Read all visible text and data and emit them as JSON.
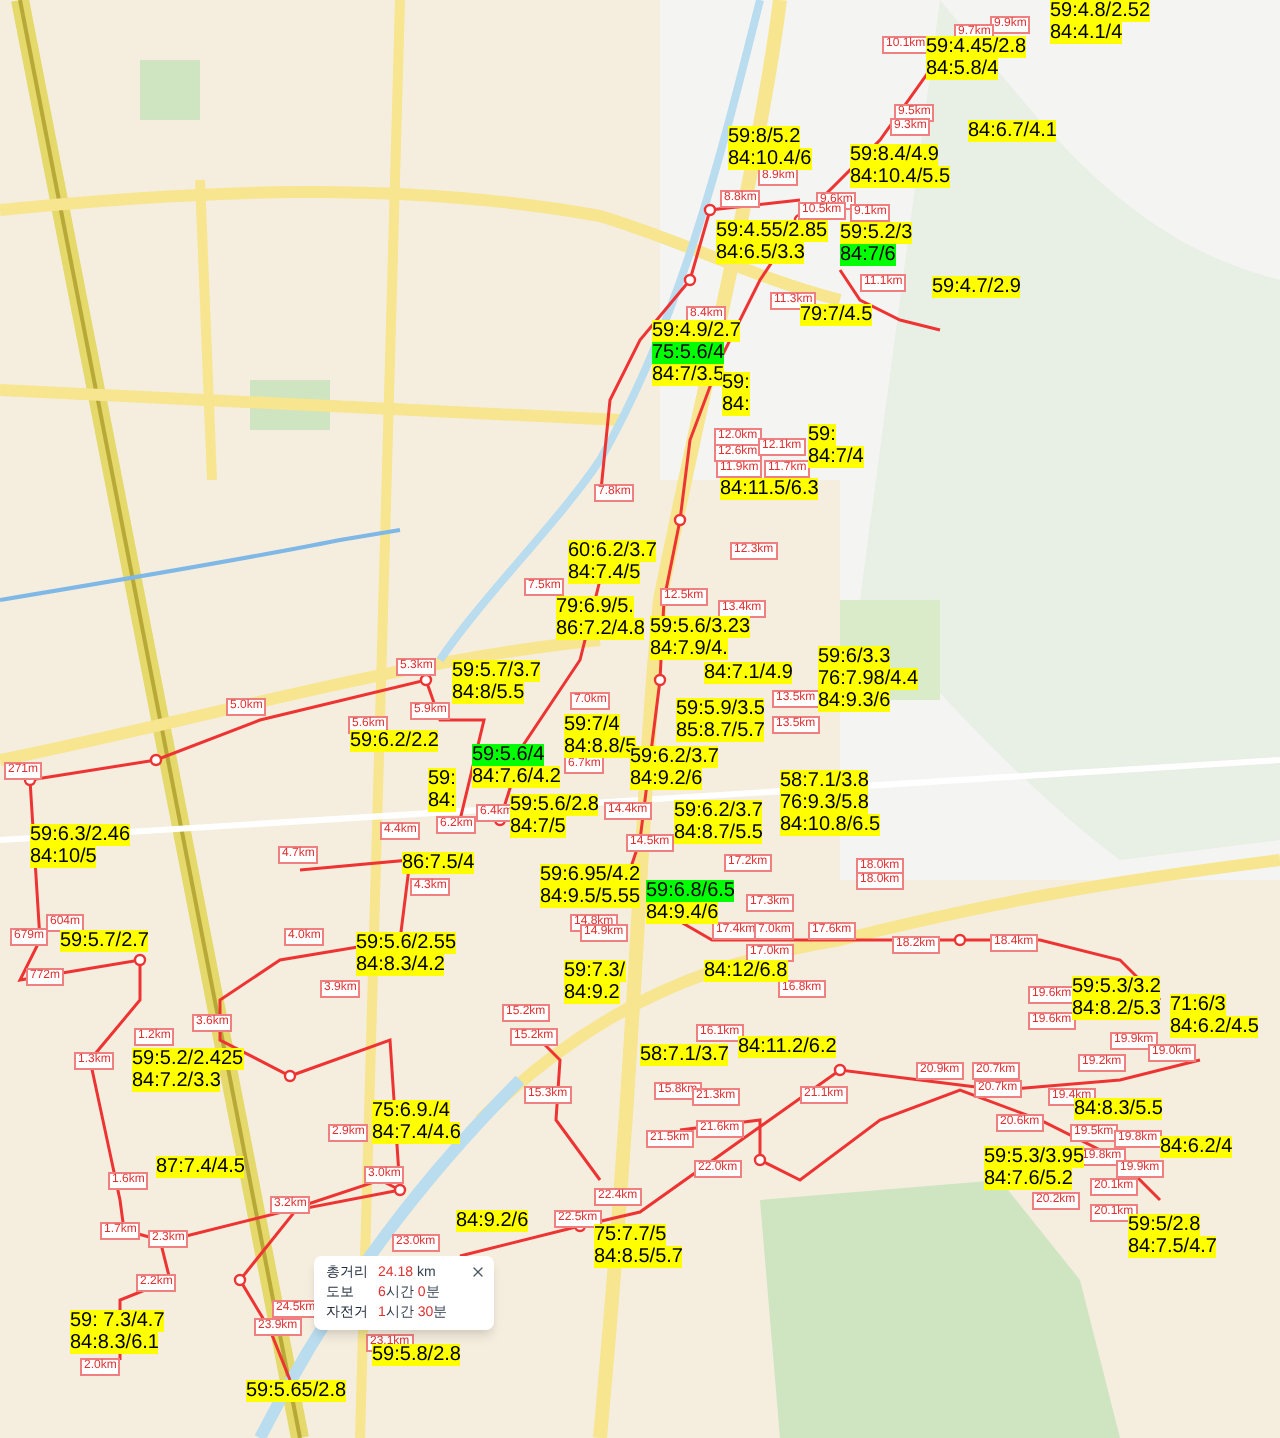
{
  "route_labels": [
    {
      "lines": [
        {
          "text": "59:4.8/2.52",
          "highlighted": false
        },
        {
          "text": "84:4.1/4",
          "highlighted": false
        }
      ]
    },
    {
      "lines": [
        {
          "text": "59:4.45/2.8",
          "highlighted": false
        },
        {
          "text": "84:5.8/4",
          "highlighted": false
        }
      ]
    },
    {
      "lines": [
        {
          "text": "84:6.7/4.1",
          "highlighted": false
        }
      ]
    },
    {
      "lines": [
        {
          "text": "59:8/5.2",
          "highlighted": false
        },
        {
          "text": "84:10.4/6",
          "highlighted": false
        }
      ]
    },
    {
      "lines": [
        {
          "text": "59:8.4/4.9",
          "highlighted": false
        },
        {
          "text": "84:10.4/5.5",
          "highlighted": false
        }
      ]
    },
    {
      "lines": [
        {
          "text": "59:4.55/2.85",
          "highlighted": false
        },
        {
          "text": "84:6.5/3.3",
          "highlighted": false
        }
      ]
    },
    {
      "lines": [
        {
          "text": "59:5.2/3",
          "highlighted": false
        },
        {
          "text": "84:7/6",
          "highlighted": true
        }
      ]
    },
    {
      "lines": [
        {
          "text": "59:4.7/2.9",
          "highlighted": false
        }
      ]
    },
    {
      "lines": [
        {
          "text": "79:7/4.5",
          "highlighted": false
        }
      ]
    },
    {
      "lines": [
        {
          "text": "59:4.9/2.7",
          "highlighted": false
        },
        {
          "text": "75:5.6/4",
          "highlighted": true
        },
        {
          "text": "84:7/3.5",
          "highlighted": false
        }
      ]
    },
    {
      "lines": [
        {
          "text": "59:",
          "highlighted": false
        },
        {
          "text": "84:",
          "highlighted": false
        }
      ]
    },
    {
      "lines": [
        {
          "text": "59:",
          "highlighted": false
        },
        {
          "text": "84:7/4",
          "highlighted": false
        }
      ]
    },
    {
      "lines": [
        {
          "text": "84:11.5/6.3",
          "highlighted": false
        }
      ]
    },
    {
      "lines": [
        {
          "text": "60:6.2/3.7",
          "highlighted": false
        },
        {
          "text": "84:7.4/5",
          "highlighted": false
        }
      ]
    },
    {
      "lines": [
        {
          "text": "79:6.9/5.",
          "highlighted": false
        },
        {
          "text": "86:7.2/4.8",
          "highlighted": false
        }
      ]
    },
    {
      "lines": [
        {
          "text": "59:5.7/3.7",
          "highlighted": false
        },
        {
          "text": "84:8/5.5",
          "highlighted": false
        }
      ]
    },
    {
      "lines": [
        {
          "text": "59:5.6/3.23",
          "highlighted": false
        },
        {
          "text": "84:7.9/4.",
          "highlighted": false
        }
      ]
    },
    {
      "lines": [
        {
          "text": "84:7.1/4.9",
          "highlighted": false
        }
      ]
    },
    {
      "lines": [
        {
          "text": "59:6/3.3",
          "highlighted": false
        },
        {
          "text": "76:7.98/4.4",
          "highlighted": false
        },
        {
          "text": "84:9.3/6",
          "highlighted": false
        }
      ]
    },
    {
      "lines": [
        {
          "text": "59:5.9/3.5",
          "highlighted": false
        },
        {
          "text": "85:8.7/5.7",
          "highlighted": false
        }
      ]
    },
    {
      "lines": [
        {
          "text": "59:6.2/2.2",
          "highlighted": false
        }
      ]
    },
    {
      "lines": [
        {
          "text": "59:7/4",
          "highlighted": false
        },
        {
          "text": "84:8.8/5",
          "highlighted": false
        }
      ]
    },
    {
      "lines": [
        {
          "text": "59:5.6/4",
          "highlighted": true
        },
        {
          "text": "84:7.6/4.2",
          "highlighted": false
        }
      ]
    },
    {
      "lines": [
        {
          "text": "59:",
          "highlighted": false
        },
        {
          "text": "84:",
          "highlighted": false
        }
      ]
    },
    {
      "lines": [
        {
          "text": "59:6.2/3.7",
          "highlighted": false
        },
        {
          "text": "84:9.2/6",
          "highlighted": false
        }
      ]
    },
    {
      "lines": [
        {
          "text": "59:5.6/2.8",
          "highlighted": false
        },
        {
          "text": "84:7/5",
          "highlighted": false
        }
      ]
    },
    {
      "lines": [
        {
          "text": "58:7.1/3.8",
          "highlighted": false
        },
        {
          "text": "76:9.3/5.8",
          "highlighted": false
        },
        {
          "text": "84:10.8/6.5",
          "highlighted": false
        }
      ]
    },
    {
      "lines": [
        {
          "text": "59:6.3/2.46",
          "highlighted": false
        },
        {
          "text": "84:10/5",
          "highlighted": false
        }
      ]
    },
    {
      "lines": [
        {
          "text": "59:6.2/3.7",
          "highlighted": false
        },
        {
          "text": "84:8.7/5.5",
          "highlighted": false
        }
      ]
    },
    {
      "lines": [
        {
          "text": "86:7.5/4",
          "highlighted": false
        }
      ]
    },
    {
      "lines": [
        {
          "text": "59:6.95/4.2",
          "highlighted": false
        },
        {
          "text": "84:9.5/5.55",
          "highlighted": false
        }
      ]
    },
    {
      "lines": [
        {
          "text": "59:6.8/6.5",
          "highlighted": true
        },
        {
          "text": "84:9.4/6",
          "highlighted": false
        }
      ]
    },
    {
      "lines": [
        {
          "text": "59:5.7/2.7",
          "highlighted": false
        }
      ]
    },
    {
      "lines": [
        {
          "text": "59:5.6/2.55",
          "highlighted": false
        },
        {
          "text": "84:8.3/4.2",
          "highlighted": false
        }
      ]
    },
    {
      "lines": [
        {
          "text": "59:7.3/",
          "highlighted": false
        },
        {
          "text": "84:9.2",
          "highlighted": false
        }
      ]
    },
    {
      "lines": [
        {
          "text": "84:12/6.8",
          "highlighted": false
        }
      ]
    },
    {
      "lines": [
        {
          "text": "59:5.2/2.425",
          "highlighted": false
        },
        {
          "text": "84:7.2/3.3",
          "highlighted": false
        }
      ]
    },
    {
      "lines": [
        {
          "text": "75:6.9./4",
          "highlighted": false
        },
        {
          "text": "84:7.4/4.6",
          "highlighted": false
        }
      ]
    },
    {
      "lines": [
        {
          "text": "87:7.4/4.5",
          "highlighted": false
        }
      ]
    },
    {
      "lines": [
        {
          "text": "84:11.2/6.2",
          "highlighted": false
        }
      ]
    },
    {
      "lines": [
        {
          "text": "58:7.1/3.7",
          "highlighted": false
        }
      ]
    },
    {
      "lines": [
        {
          "text": "59:5.3/3.2",
          "highlighted": false
        },
        {
          "text": "84:8.2/5.3",
          "highlighted": false
        }
      ]
    },
    {
      "lines": [
        {
          "text": "71:6/3",
          "highlighted": false
        },
        {
          "text": "84:6.2/4.5",
          "highlighted": false
        }
      ]
    },
    {
      "lines": [
        {
          "text": "84:8.3/5.5",
          "highlighted": false
        }
      ]
    },
    {
      "lines": [
        {
          "text": "84:6.2/4",
          "highlighted": false
        }
      ]
    },
    {
      "lines": [
        {
          "text": "59:5.3/3.95",
          "highlighted": false
        },
        {
          "text": "84:7.6/5.2",
          "highlighted": false
        }
      ]
    },
    {
      "lines": [
        {
          "text": "84:9.2/6",
          "highlighted": false
        }
      ]
    },
    {
      "lines": [
        {
          "text": "75:7.7/5",
          "highlighted": false
        },
        {
          "text": "84:8.5/5.7",
          "highlighted": false
        }
      ]
    },
    {
      "lines": [
        {
          "text": "59:5/2.8",
          "highlighted": false
        },
        {
          "text": "84:7.5/4.7",
          "highlighted": false
        }
      ]
    },
    {
      "lines": [
        {
          "text": "59: 7.3/4.7",
          "highlighted": false
        },
        {
          "text": "84:8.3/6.1",
          "highlighted": false
        }
      ]
    },
    {
      "lines": [
        {
          "text": "59:5.8/2.8",
          "highlighted": false
        }
      ]
    },
    {
      "lines": [
        {
          "text": "59:5.65/2.8",
          "highlighted": false
        }
      ]
    }
  ],
  "distance_markers": [
    "9.9km",
    "9.7km",
    "10.1km",
    "9.5km",
    "9.3km",
    "8.9km",
    "8.8km",
    "9.6km",
    "10.5km",
    "9.1km",
    "8.4km",
    "11.3km",
    "11.1km",
    "12.0km",
    "12.6km",
    "12.1km",
    "11.9km",
    "11.7km",
    "12.3km",
    "12.5km",
    "13.4km",
    "13.5km",
    "13.5km",
    "17.2km",
    "17.3km",
    "17.4km",
    "7.0km",
    "17.0km",
    "17.6km",
    "18.0km",
    "18.0km",
    "18.2km",
    "18.4km",
    "7.8km",
    "7.5km",
    "5.3km",
    "5.0km",
    "5.9km",
    "5.6km",
    "7.0km",
    "6.7km",
    "6.2km",
    "6.4km",
    "271m",
    "4.4km",
    "4.7km",
    "4.3km",
    "4.0km",
    "14.4km",
    "14.5km",
    "14.8km",
    "14.9km",
    "604m",
    "679m",
    "772m",
    "3.9km",
    "3.6km",
    "1.2km",
    "1.3km",
    "1.6km",
    "1.7km",
    "2.3km",
    "2.2km",
    "2.0km",
    "2.9km",
    "3.0km",
    "3.2km",
    "15.2km",
    "15.2km",
    "15.3km",
    "22.4km",
    "22.5km",
    "23.0km",
    "23.9km",
    "23.1km",
    "24.5km",
    "16.8km",
    "16.1km",
    "15.8km",
    "21.3km",
    "21.6km",
    "21.5km",
    "22.0km",
    "21.1km",
    "20.9km",
    "20.7km",
    "20.7km",
    "20.6km",
    "19.6km",
    "19.6km",
    "19.9km",
    "19.2km",
    "19.0km",
    "19.4km",
    "19.5km",
    "19.8km",
    "20.1km",
    "20.2km",
    "20.1km",
    "19.8km",
    "19.9km"
  ],
  "info_popup": {
    "rows": [
      {
        "label": "총거리",
        "value": [
          {
            "text": "24.18",
            "kind": "number"
          },
          {
            "text": " km",
            "kind": "unit"
          }
        ]
      },
      {
        "label": "도보",
        "value": [
          {
            "text": "6",
            "kind": "number"
          },
          {
            "text": "시간 ",
            "kind": "unit"
          },
          {
            "text": "0",
            "kind": "number"
          },
          {
            "text": "분",
            "kind": "unit"
          }
        ]
      },
      {
        "label": "자전거",
        "value": [
          {
            "text": "1",
            "kind": "number"
          },
          {
            "text": "시간 ",
            "kind": "unit"
          },
          {
            "text": "30",
            "kind": "number"
          },
          {
            "text": "분",
            "kind": "unit"
          }
        ]
      }
    ]
  }
}
